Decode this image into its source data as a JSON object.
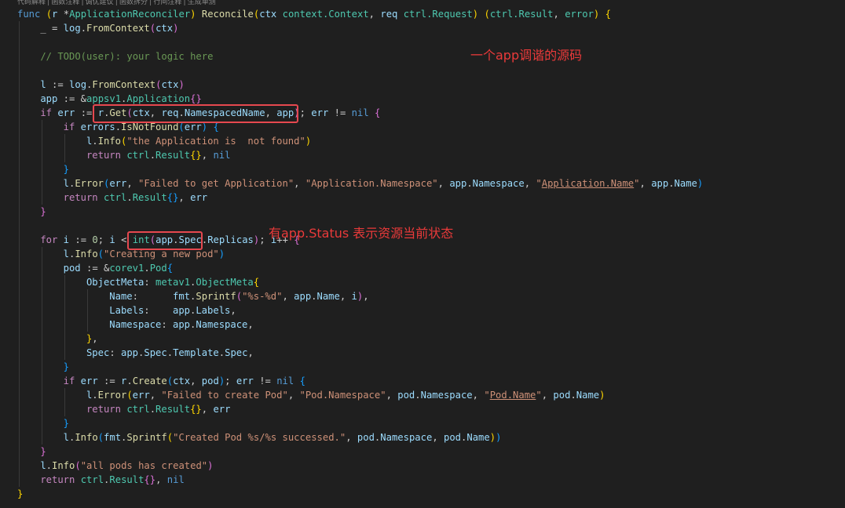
{
  "codelens": "代码解释 | 函数注释 | 调优建议 | 函数拆分 | 行间注释 | 生成单测",
  "annotations": {
    "reconcile_note": "一个app调谐的源码",
    "status_note": "有app.Status 表示资源当前状态"
  },
  "lines": [
    [
      [
        "kw",
        "func"
      ],
      [
        "p",
        " "
      ],
      [
        "br1",
        "("
      ],
      [
        "var",
        "r"
      ],
      [
        "p",
        " "
      ],
      [
        "p",
        "*"
      ],
      [
        "typ",
        "ApplicationReconciler"
      ],
      [
        "br1",
        ")"
      ],
      [
        "p",
        " "
      ],
      [
        "fn",
        "Reconcile"
      ],
      [
        "br1",
        "("
      ],
      [
        "var",
        "ctx"
      ],
      [
        "p",
        " "
      ],
      [
        "typ",
        "context.Context"
      ],
      [
        "p",
        ", "
      ],
      [
        "var",
        "req"
      ],
      [
        "p",
        " "
      ],
      [
        "typ",
        "ctrl.Request"
      ],
      [
        "br1",
        ")"
      ],
      [
        "p",
        " "
      ],
      [
        "br1",
        "("
      ],
      [
        "typ",
        "ctrl.Result"
      ],
      [
        "p",
        ", "
      ],
      [
        "typ",
        "error"
      ],
      [
        "br1",
        ")"
      ],
      [
        "p",
        " "
      ],
      [
        "br1",
        "{"
      ]
    ],
    [
      [
        "p",
        "_ = "
      ],
      [
        "var",
        "log"
      ],
      [
        "p",
        "."
      ],
      [
        "fn",
        "FromContext"
      ],
      [
        "br2",
        "("
      ],
      [
        "var",
        "ctx"
      ],
      [
        "br2",
        ")"
      ]
    ],
    [],
    [
      [
        "cmt",
        "// TODO(user): your logic here"
      ]
    ],
    [],
    [
      [
        "var",
        "l"
      ],
      [
        "p",
        " := "
      ],
      [
        "var",
        "log"
      ],
      [
        "p",
        "."
      ],
      [
        "fn",
        "FromContext"
      ],
      [
        "br2",
        "("
      ],
      [
        "var",
        "ctx"
      ],
      [
        "br2",
        ")"
      ]
    ],
    [
      [
        "var",
        "app"
      ],
      [
        "p",
        " := &"
      ],
      [
        "typ",
        "appsv1"
      ],
      [
        "p",
        "."
      ],
      [
        "typ",
        "Application"
      ],
      [
        "br2",
        "{}"
      ]
    ],
    [
      [
        "ctl",
        "if"
      ],
      [
        "p",
        " "
      ],
      [
        "var",
        "err"
      ],
      [
        "p",
        " := "
      ],
      [
        "var",
        "r"
      ],
      [
        "p",
        "."
      ],
      [
        "fn",
        "Get"
      ],
      [
        "br2",
        "("
      ],
      [
        "var",
        "ctx"
      ],
      [
        "p",
        ", "
      ],
      [
        "var",
        "req"
      ],
      [
        "p",
        "."
      ],
      [
        "var",
        "NamespacedName"
      ],
      [
        "p",
        ", "
      ],
      [
        "var",
        "app"
      ],
      [
        "br2",
        ")"
      ],
      [
        "p",
        "; "
      ],
      [
        "var",
        "err"
      ],
      [
        "p",
        " != "
      ],
      [
        "kw",
        "nil"
      ],
      [
        "p",
        " "
      ],
      [
        "br2",
        "{"
      ]
    ],
    [
      [
        "ctl",
        "if"
      ],
      [
        "p",
        " "
      ],
      [
        "var",
        "errors"
      ],
      [
        "p",
        "."
      ],
      [
        "fn",
        "IsNotFound"
      ],
      [
        "br3",
        "("
      ],
      [
        "var",
        "err"
      ],
      [
        "br3",
        ")"
      ],
      [
        "p",
        " "
      ],
      [
        "br3",
        "{"
      ]
    ],
    [
      [
        "var",
        "l"
      ],
      [
        "p",
        "."
      ],
      [
        "fn",
        "Info"
      ],
      [
        "br1",
        "("
      ],
      [
        "str",
        "\"the Application is  not found\""
      ],
      [
        "br1",
        ")"
      ]
    ],
    [
      [
        "ctl",
        "return"
      ],
      [
        "p",
        " "
      ],
      [
        "typ",
        "ctrl"
      ],
      [
        "p",
        "."
      ],
      [
        "typ",
        "Result"
      ],
      [
        "br1",
        "{}"
      ],
      [
        "p",
        ", "
      ],
      [
        "kw",
        "nil"
      ]
    ],
    [
      [
        "br3",
        "}"
      ]
    ],
    [
      [
        "var",
        "l"
      ],
      [
        "p",
        "."
      ],
      [
        "fn",
        "Error"
      ],
      [
        "br3",
        "("
      ],
      [
        "var",
        "err"
      ],
      [
        "p",
        ", "
      ],
      [
        "str",
        "\"Failed to get Application\""
      ],
      [
        "p",
        ", "
      ],
      [
        "str",
        "\"Application.Namespace\""
      ],
      [
        "p",
        ", "
      ],
      [
        "var",
        "app"
      ],
      [
        "p",
        "."
      ],
      [
        "var",
        "Namespace"
      ],
      [
        "p",
        ", "
      ],
      [
        "str",
        "\""
      ],
      [
        "strul",
        "Application.Name"
      ],
      [
        "str",
        "\""
      ],
      [
        "p",
        ", "
      ],
      [
        "var",
        "app"
      ],
      [
        "p",
        "."
      ],
      [
        "var",
        "Name"
      ],
      [
        "br3",
        ")"
      ]
    ],
    [
      [
        "ctl",
        "return"
      ],
      [
        "p",
        " "
      ],
      [
        "typ",
        "ctrl"
      ],
      [
        "p",
        "."
      ],
      [
        "typ",
        "Result"
      ],
      [
        "br3",
        "{}"
      ],
      [
        "p",
        ", "
      ],
      [
        "var",
        "err"
      ]
    ],
    [
      [
        "br2",
        "}"
      ]
    ],
    [],
    [
      [
        "ctl",
        "for"
      ],
      [
        "p",
        " "
      ],
      [
        "var",
        "i"
      ],
      [
        "p",
        " := "
      ],
      [
        "num",
        "0"
      ],
      [
        "p",
        "; "
      ],
      [
        "var",
        "i"
      ],
      [
        "p",
        " < "
      ],
      [
        "typ",
        "int"
      ],
      [
        "br2",
        "("
      ],
      [
        "var",
        "app"
      ],
      [
        "p",
        "."
      ],
      [
        "var",
        "Spec"
      ],
      [
        "p",
        "."
      ],
      [
        "var",
        "Replicas"
      ],
      [
        "br2",
        ")"
      ],
      [
        "p",
        "; "
      ],
      [
        "var",
        "i"
      ],
      [
        "p",
        "++ "
      ],
      [
        "br2",
        "{"
      ]
    ],
    [
      [
        "var",
        "l"
      ],
      [
        "p",
        "."
      ],
      [
        "fn",
        "Info"
      ],
      [
        "br3",
        "("
      ],
      [
        "str",
        "\"Creating a new pod\""
      ],
      [
        "br3",
        ")"
      ]
    ],
    [
      [
        "var",
        "pod"
      ],
      [
        "p",
        " := &"
      ],
      [
        "typ",
        "corev1"
      ],
      [
        "p",
        "."
      ],
      [
        "typ",
        "Pod"
      ],
      [
        "br3",
        "{"
      ]
    ],
    [
      [
        "var",
        "ObjectMeta"
      ],
      [
        "p",
        ": "
      ],
      [
        "typ",
        "metav1"
      ],
      [
        "p",
        "."
      ],
      [
        "typ",
        "ObjectMeta"
      ],
      [
        "br1",
        "{"
      ]
    ],
    [
      [
        "var",
        "Name"
      ],
      [
        "p",
        ":      "
      ],
      [
        "var",
        "fmt"
      ],
      [
        "p",
        "."
      ],
      [
        "fn",
        "Sprintf"
      ],
      [
        "br2",
        "("
      ],
      [
        "str",
        "\"%s-%d\""
      ],
      [
        "p",
        ", "
      ],
      [
        "var",
        "app"
      ],
      [
        "p",
        "."
      ],
      [
        "var",
        "Name"
      ],
      [
        "p",
        ", "
      ],
      [
        "var",
        "i"
      ],
      [
        "br2",
        ")"
      ],
      [
        "p",
        ","
      ]
    ],
    [
      [
        "var",
        "Labels"
      ],
      [
        "p",
        ":    "
      ],
      [
        "var",
        "app"
      ],
      [
        "p",
        "."
      ],
      [
        "var",
        "Labels"
      ],
      [
        "p",
        ","
      ]
    ],
    [
      [
        "var",
        "Namespace"
      ],
      [
        "p",
        ": "
      ],
      [
        "var",
        "app"
      ],
      [
        "p",
        "."
      ],
      [
        "var",
        "Namespace"
      ],
      [
        "p",
        ","
      ]
    ],
    [
      [
        "br1",
        "}"
      ],
      [
        "p",
        ","
      ]
    ],
    [
      [
        "var",
        "Spec"
      ],
      [
        "p",
        ": "
      ],
      [
        "var",
        "app"
      ],
      [
        "p",
        "."
      ],
      [
        "var",
        "Spec"
      ],
      [
        "p",
        "."
      ],
      [
        "var",
        "Template"
      ],
      [
        "p",
        "."
      ],
      [
        "var",
        "Spec"
      ],
      [
        "p",
        ","
      ]
    ],
    [
      [
        "br3",
        "}"
      ]
    ],
    [
      [
        "ctl",
        "if"
      ],
      [
        "p",
        " "
      ],
      [
        "var",
        "err"
      ],
      [
        "p",
        " := "
      ],
      [
        "var",
        "r"
      ],
      [
        "p",
        "."
      ],
      [
        "fn",
        "Create"
      ],
      [
        "br3",
        "("
      ],
      [
        "var",
        "ctx"
      ],
      [
        "p",
        ", "
      ],
      [
        "var",
        "pod"
      ],
      [
        "br3",
        ")"
      ],
      [
        "p",
        "; "
      ],
      [
        "var",
        "err"
      ],
      [
        "p",
        " != "
      ],
      [
        "kw",
        "nil"
      ],
      [
        "p",
        " "
      ],
      [
        "br3",
        "{"
      ]
    ],
    [
      [
        "var",
        "l"
      ],
      [
        "p",
        "."
      ],
      [
        "fn",
        "Error"
      ],
      [
        "br1",
        "("
      ],
      [
        "var",
        "err"
      ],
      [
        "p",
        ", "
      ],
      [
        "str",
        "\"Failed to create Pod\""
      ],
      [
        "p",
        ", "
      ],
      [
        "str",
        "\"Pod.Namespace\""
      ],
      [
        "p",
        ", "
      ],
      [
        "var",
        "pod"
      ],
      [
        "p",
        "."
      ],
      [
        "var",
        "Namespace"
      ],
      [
        "p",
        ", "
      ],
      [
        "str",
        "\""
      ],
      [
        "strul",
        "Pod.Name"
      ],
      [
        "str",
        "\""
      ],
      [
        "p",
        ", "
      ],
      [
        "var",
        "pod"
      ],
      [
        "p",
        "."
      ],
      [
        "var",
        "Name"
      ],
      [
        "br1",
        ")"
      ]
    ],
    [
      [
        "ctl",
        "return"
      ],
      [
        "p",
        " "
      ],
      [
        "typ",
        "ctrl"
      ],
      [
        "p",
        "."
      ],
      [
        "typ",
        "Result"
      ],
      [
        "br1",
        "{}"
      ],
      [
        "p",
        ", "
      ],
      [
        "var",
        "err"
      ]
    ],
    [
      [
        "br3",
        "}"
      ]
    ],
    [
      [
        "var",
        "l"
      ],
      [
        "p",
        "."
      ],
      [
        "fn",
        "Info"
      ],
      [
        "br3",
        "("
      ],
      [
        "var",
        "fmt"
      ],
      [
        "p",
        "."
      ],
      [
        "fn",
        "Sprintf"
      ],
      [
        "br1",
        "("
      ],
      [
        "str",
        "\"Created Pod %s/%s successed.\""
      ],
      [
        "p",
        ", "
      ],
      [
        "var",
        "pod"
      ],
      [
        "p",
        "."
      ],
      [
        "var",
        "Namespace"
      ],
      [
        "p",
        ", "
      ],
      [
        "var",
        "pod"
      ],
      [
        "p",
        "."
      ],
      [
        "var",
        "Name"
      ],
      [
        "br1",
        ")"
      ],
      [
        "br3",
        ")"
      ]
    ],
    [
      [
        "br2",
        "}"
      ]
    ],
    [
      [
        "var",
        "l"
      ],
      [
        "p",
        "."
      ],
      [
        "fn",
        "Info"
      ],
      [
        "br2",
        "("
      ],
      [
        "str",
        "\"all pods has created\""
      ],
      [
        "br2",
        ")"
      ]
    ],
    [
      [
        "ctl",
        "return"
      ],
      [
        "p",
        " "
      ],
      [
        "typ",
        "ctrl"
      ],
      [
        "p",
        "."
      ],
      [
        "typ",
        "Result"
      ],
      [
        "br2",
        "{}"
      ],
      [
        "p",
        ", "
      ],
      [
        "kw",
        "nil"
      ]
    ],
    [
      [
        "br1",
        "}"
      ]
    ]
  ]
}
